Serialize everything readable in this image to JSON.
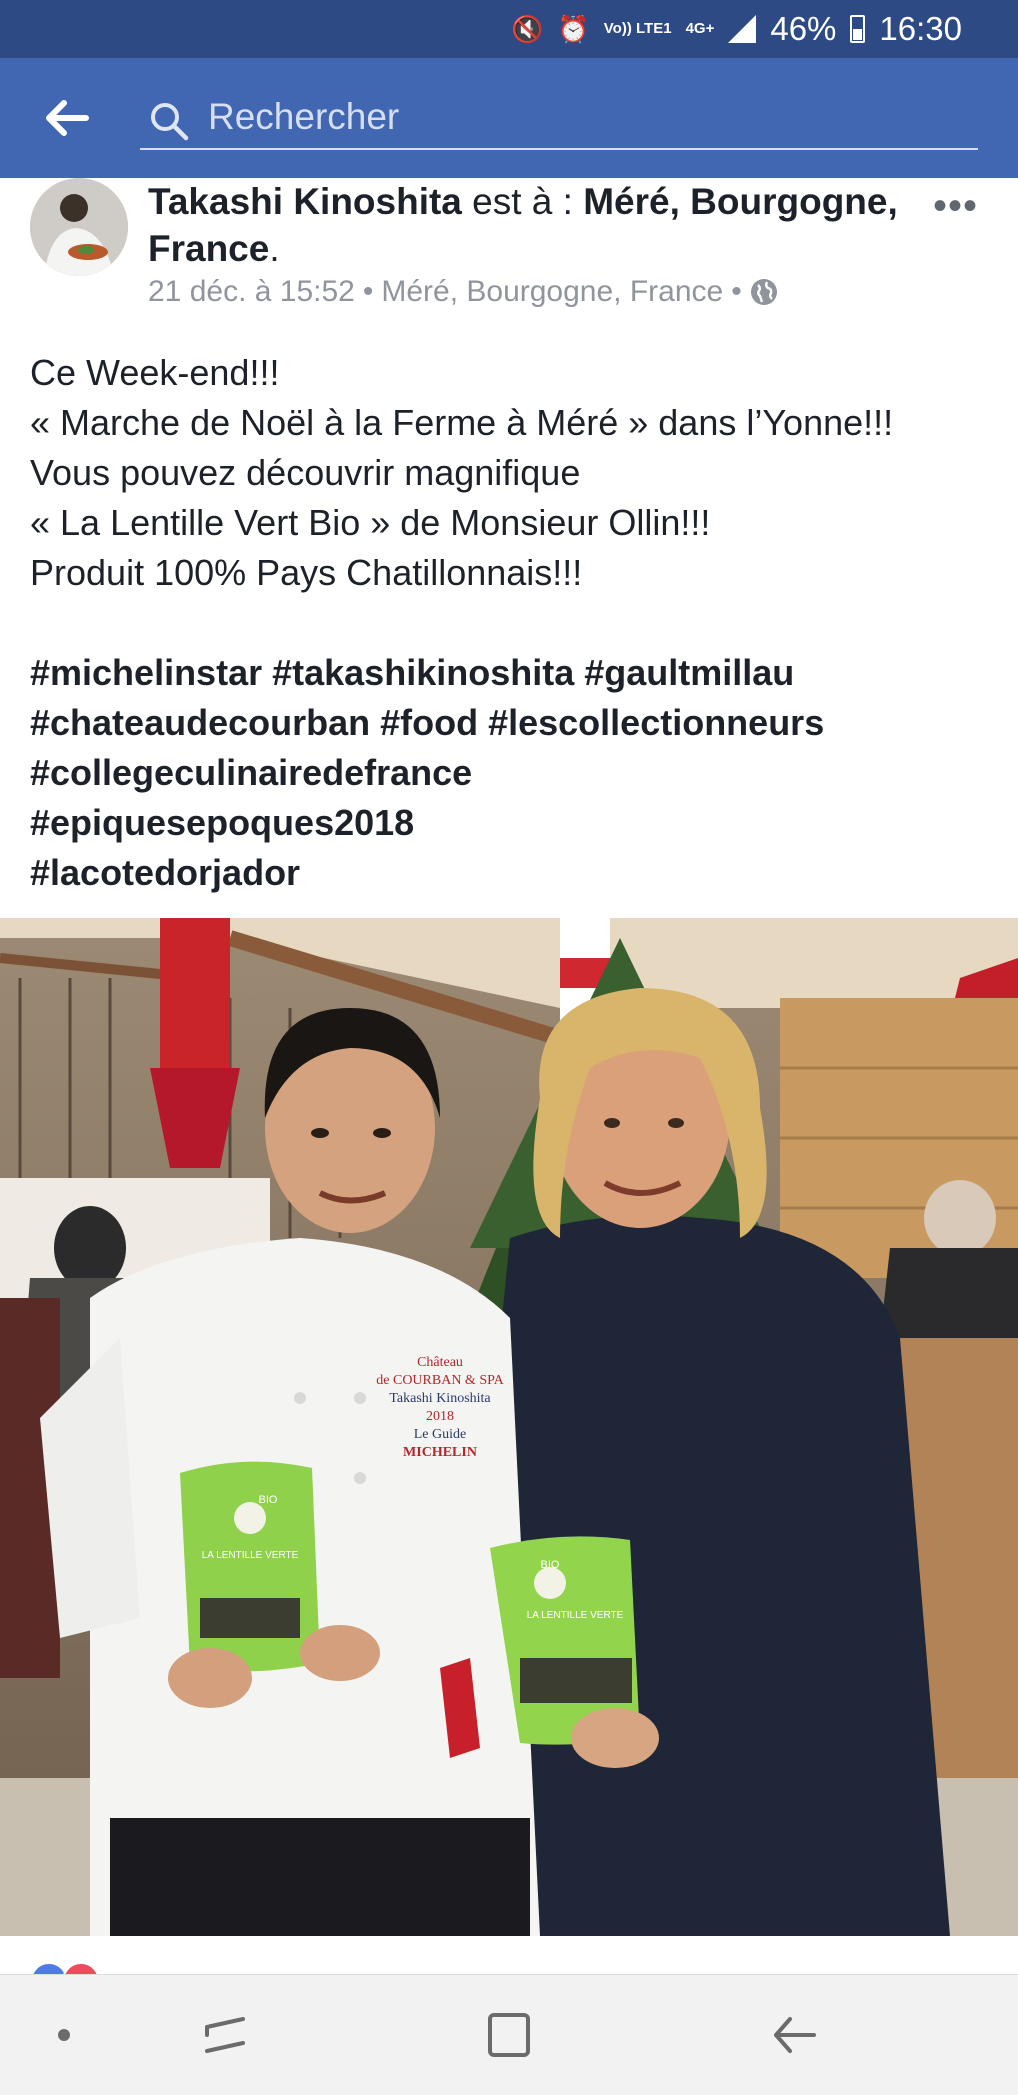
{
  "status_bar": {
    "network": "Vo)) LTE1",
    "network_type": "4G+",
    "battery": "46%",
    "time": "16:30"
  },
  "header": {
    "search_placeholder": "Rechercher",
    "icons": [
      "back-arrow-icon",
      "search-icon"
    ]
  },
  "post": {
    "author": "Takashi Kinoshita",
    "location_prefix": "est à :",
    "location": "Méré, Bourgogne, France",
    "location_suffix": ".",
    "timestamp": "21 déc. à 15:52",
    "meta_location": "Méré, Bourgogne, France",
    "separator": "•",
    "privacy_icon": "globe-icon",
    "more_label": "•••",
    "text_lines": [
      "Ce Week-end!!!",
      "« Marche de Noël à la Ferme à Méré » dans l’Yonne!!!",
      "Vous pouvez découvrir magnifique",
      "« La Lentille Vert Bio » de Monsieur Ollin!!!",
      "Produit 100% Pays Chatillonnais!!!"
    ],
    "hashtag_lines": [
      "#michelinstar #takashikinoshita #gaultmillau",
      "#chateaudecourban #food #lescollectionneurs",
      "#collegeculinairedefrance",
      "#epiquesepoques2018",
      "#lacotedorjador"
    ],
    "photo": {
      "jacket_text": [
        "Château",
        "de COURBAN & SPA",
        "Takashi Kinoshita",
        "2018",
        "Le Guide",
        "MICHELIN"
      ],
      "package_text": [
        "BIO",
        "LA LENTILLE VERTE"
      ]
    }
  },
  "colors": {
    "status_bar": "#2e4a84",
    "header": "#4267b2",
    "text": "#1d2129",
    "meta": "#90949c"
  },
  "nav": {
    "icons": [
      "home-dot-icon",
      "recent-apps-icon",
      "home-square-icon",
      "back-icon"
    ]
  }
}
